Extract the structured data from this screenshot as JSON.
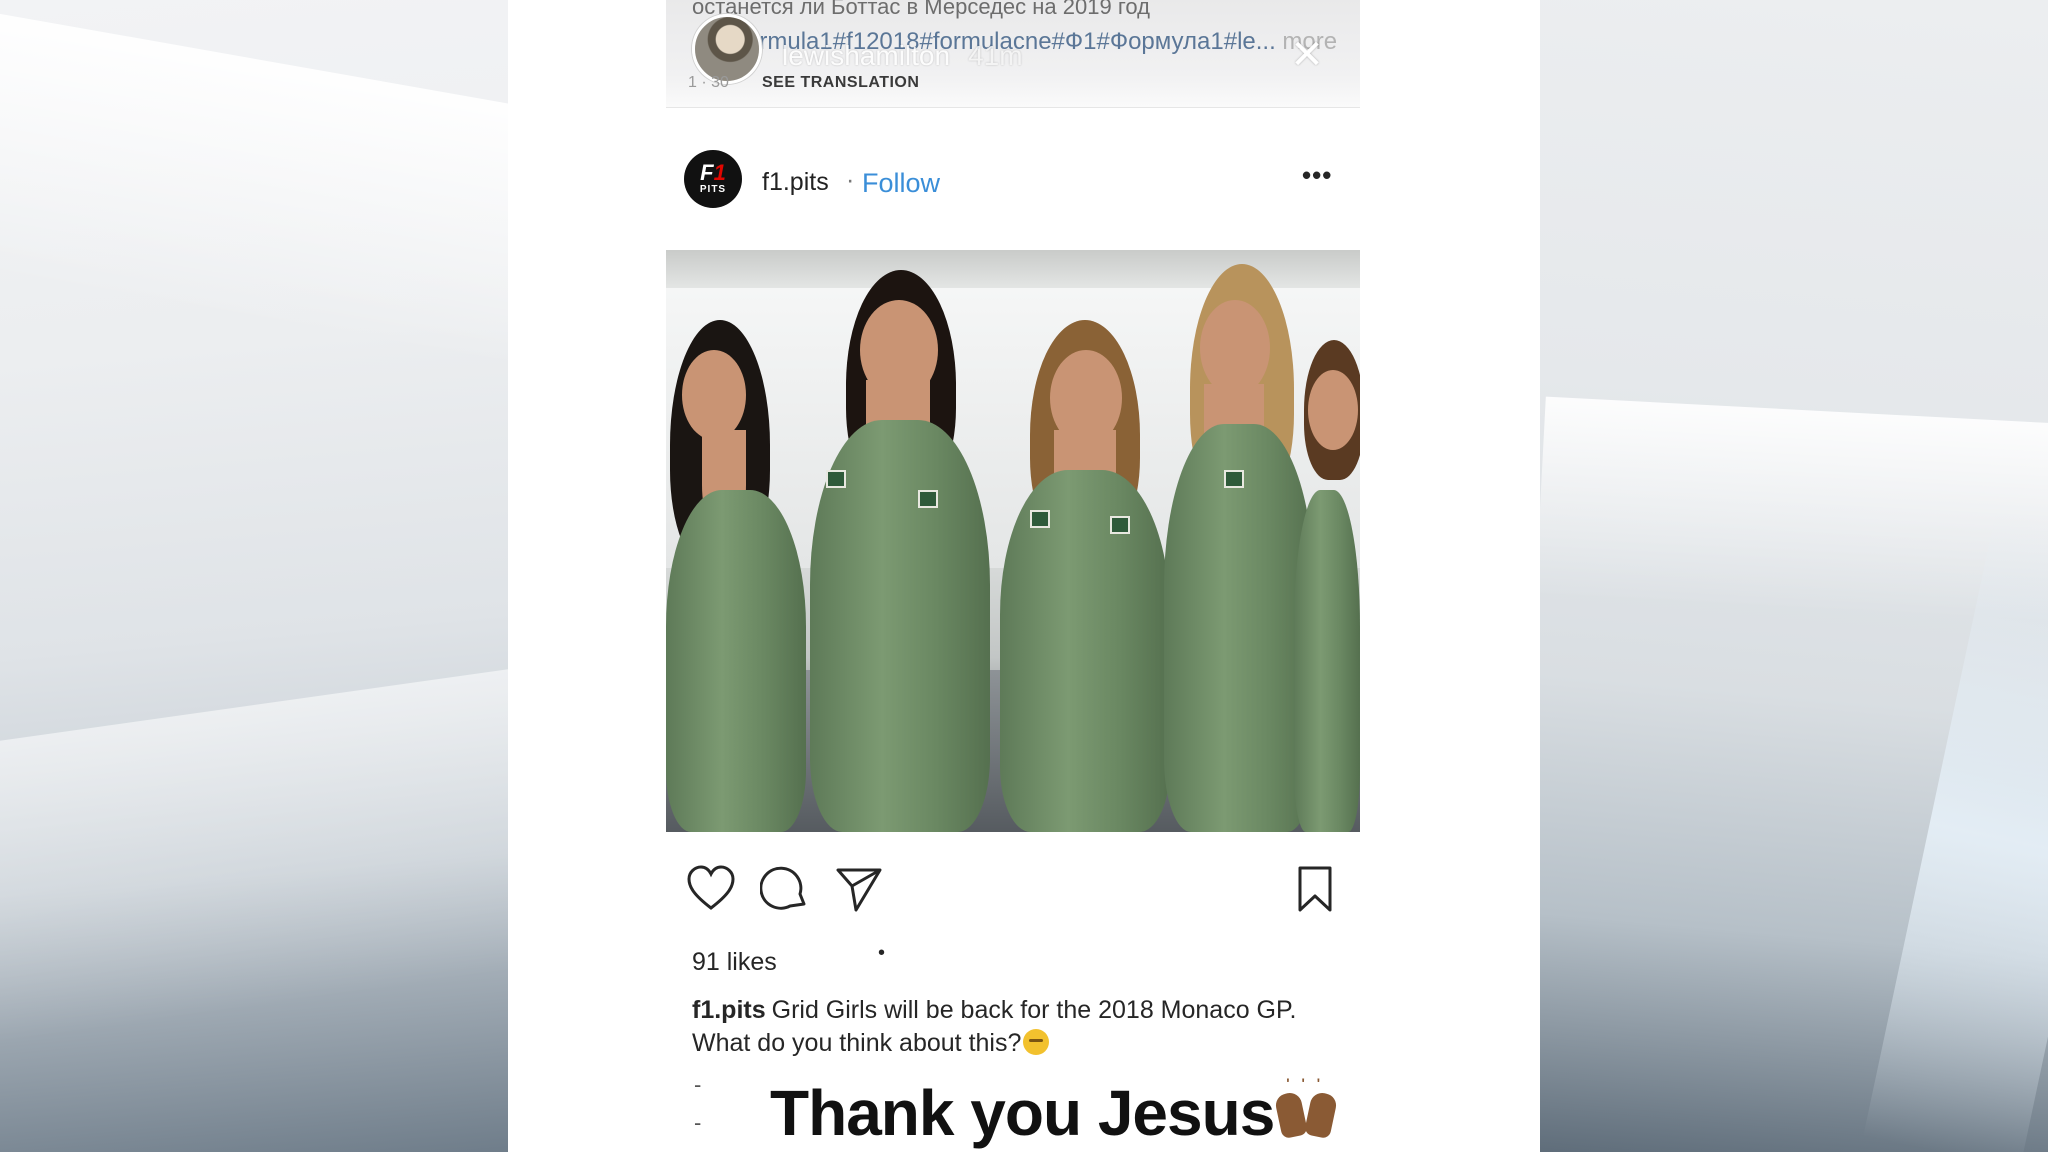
{
  "story": {
    "ru_caption": "останется ли Боттас в Мерседес на 2019 год",
    "hashtags": "#formula1#f12018#formulacne#Ф1#Формула1#le...",
    "more_label": "more",
    "username": "lewishamilton",
    "time": "41m",
    "see_translation": "SEE TRANSLATION",
    "close_icon": "close-icon"
  },
  "post": {
    "avatar_text_top": "F1",
    "avatar_text_bottom": "PITS",
    "username": "f1.pits",
    "separator": "·",
    "follow_label": "Follow",
    "more_icon": "•••",
    "colors": {
      "follow": "#3a8ed8",
      "suit": "#6a8862"
    }
  },
  "actions": {
    "icons": [
      "heart-icon",
      "comment-icon",
      "share-icon",
      "bookmark-icon"
    ]
  },
  "likes": "91 likes",
  "likes_dot": "•",
  "caption": {
    "username": "f1.pits",
    "text": "Grid Girls will be back for the 2018 Monaco GP. What do you think about this?"
  },
  "overlay_text": "Thank you Jesus"
}
